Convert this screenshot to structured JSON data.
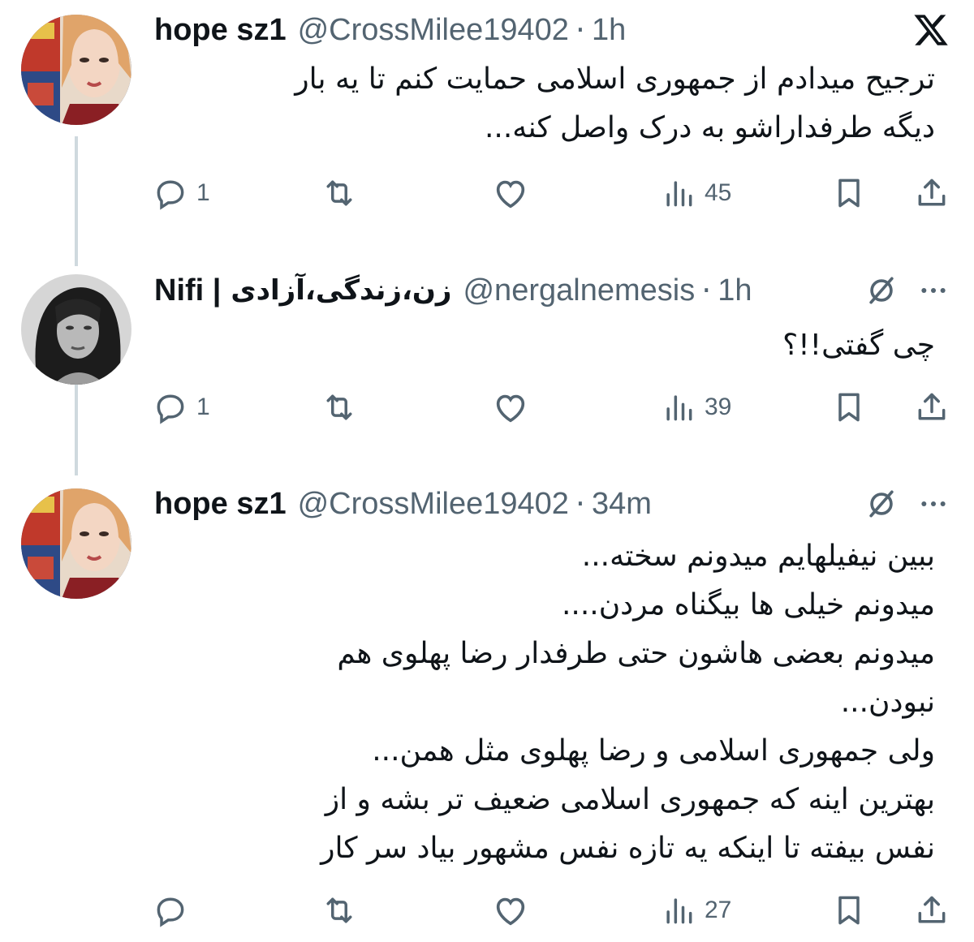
{
  "brand": {
    "logo_icon": "x-logo-icon",
    "accent": "#0f1419",
    "muted": "#536471",
    "thread_line": "#cfd9de"
  },
  "tweets": [
    {
      "name": "hope sz1",
      "name_rtl": "",
      "handle": "@CrossMilee19402",
      "time": "1h",
      "text_lines": [
        "ترجیح میدادم از جمهوری اسلامی حمایت کنم تا یه بار",
        "دیگه طرفداراشو به درک واصل کنه..."
      ],
      "replies": "1",
      "reposts": "",
      "likes": "",
      "views": "45"
    },
    {
      "name": "Nifi |",
      "name_rtl": "زن،زندگی،آزادی",
      "handle": "@nergalnemesis",
      "time": "1h",
      "text_lines": [
        "چی گفتی!!؟"
      ],
      "replies": "1",
      "reposts": "",
      "likes": "",
      "views": "39"
    },
    {
      "name": "hope sz1",
      "name_rtl": "",
      "handle": "@CrossMilee19402",
      "time": "34m",
      "text_lines": [
        "ببین نیفیلهایم میدونم سخته...",
        "میدونم خیلی ها بیگناه مردن....",
        "میدونم بعضی هاشون حتی طرفدار رضا پهلوی هم",
        "نبودن...",
        "ولی جمهوری اسلامی و رضا پهلوی مثل همن...",
        "بهترین اینه که جمهوری اسلامی ضعیف تر بشه و از",
        "نفس بیفته تا اینکه یه تازه نفس مشهور بیاد سر کار"
      ],
      "replies": "",
      "reposts": "",
      "likes": "",
      "views": "27"
    }
  ]
}
